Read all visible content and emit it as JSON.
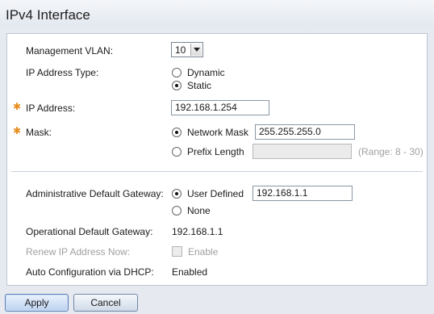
{
  "page": {
    "title": "IPv4 Interface"
  },
  "form": {
    "management_vlan": {
      "label": "Management VLAN:",
      "value": "10"
    },
    "ip_address_type": {
      "label": "IP Address Type:",
      "options": [
        {
          "label": "Dynamic",
          "checked": false
        },
        {
          "label": "Static",
          "checked": true
        }
      ]
    },
    "ip_address": {
      "label": "IP Address:",
      "value": "192.168.1.254"
    },
    "mask": {
      "label": "Mask:",
      "network_mask_label": "Network Mask",
      "network_mask_value": "255.255.255.0",
      "prefix_length_label": "Prefix Length",
      "prefix_length_value": "",
      "range_hint": "(Range: 8 - 30)"
    },
    "admin_gateway": {
      "label": "Administrative Default Gateway:",
      "user_defined_label": "User Defined",
      "user_defined_value": "192.168.1.1",
      "none_label": "None"
    },
    "operational_gateway": {
      "label": "Operational Default Gateway:",
      "value": "192.168.1.1"
    },
    "renew_ip": {
      "label": "Renew IP Address Now:",
      "checkbox_label": "Enable"
    },
    "auto_config": {
      "label": "Auto Configuration via DHCP:",
      "value": "Enabled"
    }
  },
  "buttons": {
    "apply": "Apply",
    "cancel": "Cancel"
  },
  "colors": {
    "required_marker": "#e88b1b",
    "panel_border": "#bcc6d2",
    "background": "#e6eaf0"
  },
  "icons": {
    "required": "required-asterisk-icon",
    "dropdown": "chevron-down-icon"
  }
}
